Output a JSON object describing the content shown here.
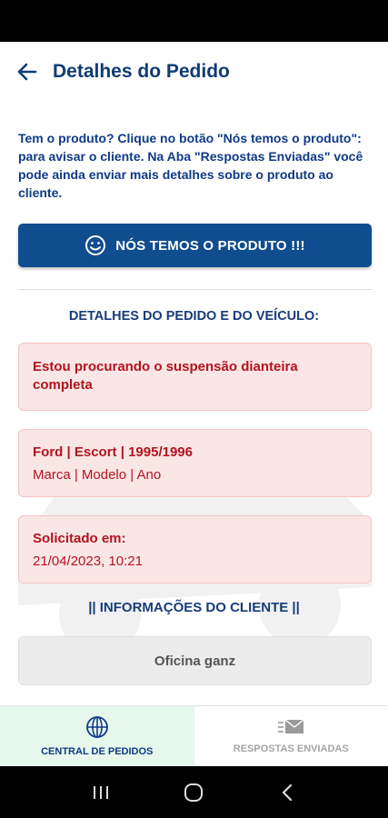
{
  "header": {
    "title": "Detalhes do Pedido",
    "back_icon": "arrow-left-icon"
  },
  "intro_text": "Tem o produto? Clique no botão \"Nós temos o produto\": para avisar o cliente. Na Aba \"Respostas Enviadas\" você pode ainda enviar mais detalhes sobre o produto ao cliente.",
  "primary_button": {
    "label": "NÓS TEMOS O PRODUTO !!!",
    "icon": "smiley-icon"
  },
  "details": {
    "section_title": "DETALHES DO PEDIDO E DO VEÍCULO:",
    "request_text": "Estou procurando o suspensão dianteira completa",
    "vehicle": {
      "value": "Ford | Escort | 1995/1996",
      "caption": "Marca | Modelo | Ano"
    },
    "requested": {
      "label": "Solicitado em:",
      "value": "21/04/2023, 10:21"
    }
  },
  "client": {
    "section_title": "|| INFORMAÇÕES DO CLIENTE ||",
    "name": "Oficina ganz"
  },
  "bottom_nav": [
    {
      "label": "CENTRAL DE PEDIDOS",
      "icon": "globe-icon",
      "active": true
    },
    {
      "label": "RESPOSTAS ENVIADAS",
      "icon": "mail-icon",
      "active": false
    }
  ],
  "colors": {
    "primary": "#0f4d8f",
    "title": "#0e3c77",
    "card_bg": "#fbe6e6",
    "card_text": "#b2141f",
    "nav_active_bg": "#e6f7ec"
  }
}
